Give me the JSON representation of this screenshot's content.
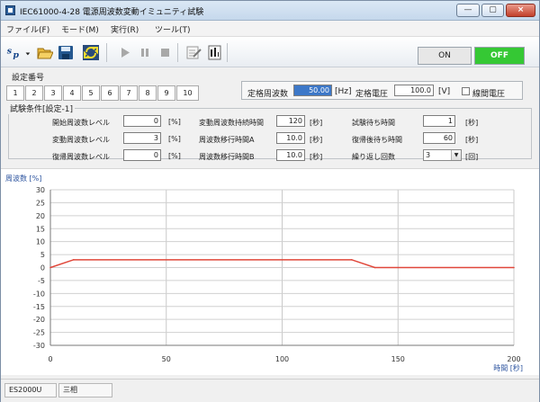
{
  "window": {
    "title": "IEC61000-4-28 電源周波数変動イミュニティ試験"
  },
  "menubar": {
    "items": [
      {
        "label": "ファイル(F)"
      },
      {
        "label": "モード(M)"
      },
      {
        "label": "実行(R)"
      },
      {
        "label": "ツール(T)"
      }
    ]
  },
  "toolbar": {
    "on_label": "ON",
    "off_label": "OFF",
    "on_color": "#e7e7e7",
    "off_color": "#35c834"
  },
  "settings": {
    "number_label": "設定番号",
    "numbers": [
      "1",
      "2",
      "3",
      "4",
      "5",
      "6",
      "7",
      "8",
      "9",
      "10"
    ]
  },
  "rated": {
    "freq_label": "定格周波数",
    "freq_value": "50.00",
    "freq_unit": "[Hz]",
    "voltage_label": "定格電圧",
    "voltage_value": "100.0",
    "voltage_unit": "[V]",
    "line_voltage_label": "線間電圧"
  },
  "conditions": {
    "title": "試験条件[設定-1]",
    "rows": [
      {
        "left_label": "開始周波数レベル",
        "left_value": "0",
        "left_unit": "[%]",
        "mid_label": "変動周波数持続時間",
        "mid_value": "120",
        "mid_unit": "[秒]",
        "right_label": "試験待ち時間",
        "right_value": "1",
        "right_unit": "[秒]"
      },
      {
        "left_label": "変動周波数レベル",
        "left_value": "3",
        "left_unit": "[%]",
        "mid_label": "周波数移行時間A",
        "mid_value": "10.0",
        "mid_unit": "[秒]",
        "right_label": "復帰後待ち時間",
        "right_value": "60",
        "right_unit": "[秒]"
      },
      {
        "left_label": "復帰周波数レベル",
        "left_value": "0",
        "left_unit": "[%]",
        "mid_label": "周波数移行時間B",
        "mid_value": "10.0",
        "mid_unit": "[秒]",
        "right_label": "繰り返し回数",
        "right_value": "3",
        "right_unit": "[回]"
      }
    ]
  },
  "chart_data": {
    "type": "line",
    "ylabel": "周波数 [%]",
    "xlabel": "時間 [秒]",
    "xlim": [
      0,
      200
    ],
    "ylim": [
      -30,
      30
    ],
    "xticks": [
      0,
      50,
      100,
      150,
      200
    ],
    "yticks": [
      30,
      25,
      20,
      15,
      10,
      5,
      0,
      -5,
      -10,
      -15,
      -20,
      -25,
      -30
    ],
    "grid": true,
    "series": [
      {
        "color": "#e0473a",
        "x": [
          0,
          10,
          130,
          140,
          200
        ],
        "y": [
          0,
          3,
          3,
          0,
          0
        ]
      }
    ]
  },
  "status": {
    "device": "ES2000U",
    "phase": "三相"
  }
}
